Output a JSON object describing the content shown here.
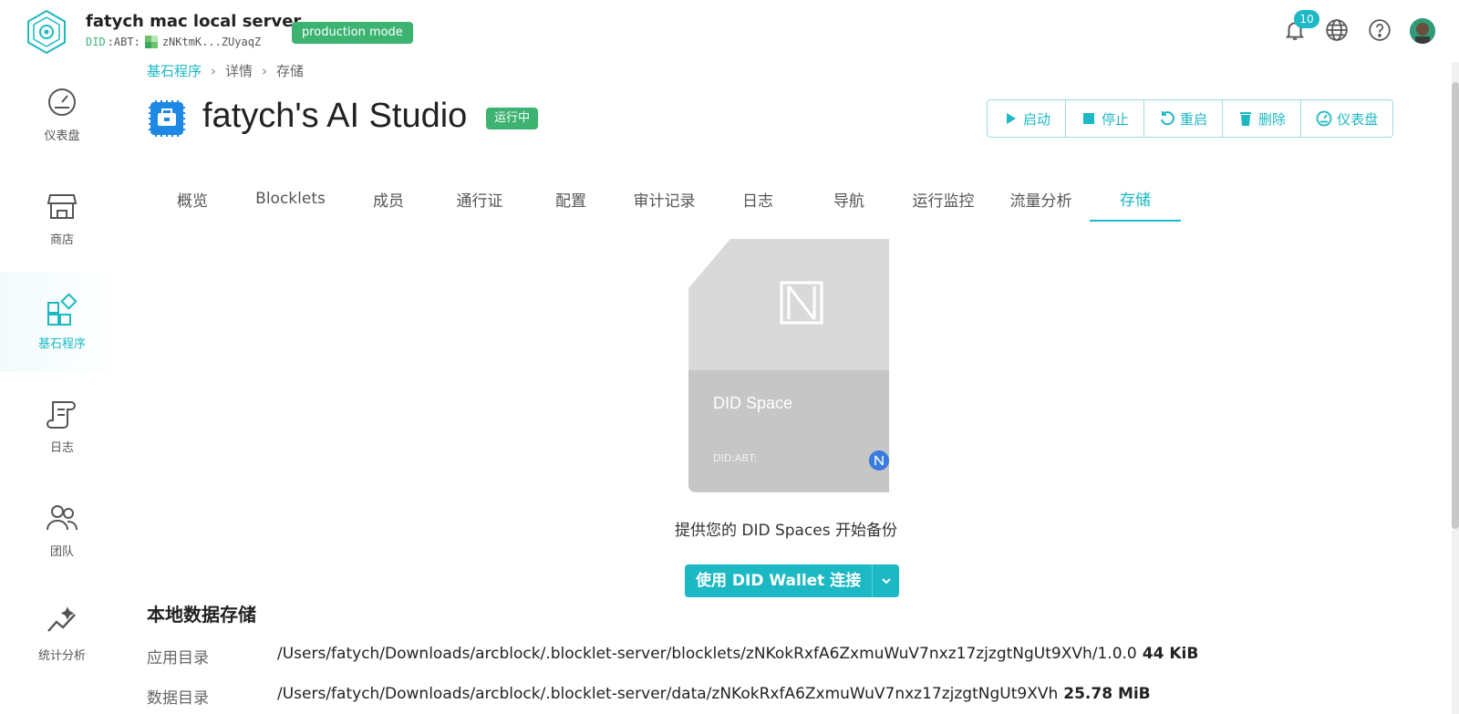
{
  "header": {
    "server_name": "fatych mac local server",
    "did_prefix": "DID",
    "did_type": ":ABT:",
    "did_short": "zNKtmK...ZUyaqZ",
    "mode_badge": "production mode",
    "notification_count": "10"
  },
  "sidebar": {
    "items": [
      {
        "label": "仪表盘",
        "icon": "gauge-icon"
      },
      {
        "label": "商店",
        "icon": "store-icon"
      },
      {
        "label": "基石程序",
        "icon": "apps-icon",
        "active": true
      },
      {
        "label": "日志",
        "icon": "scroll-icon"
      },
      {
        "label": "团队",
        "icon": "team-icon"
      },
      {
        "label": "统计分析",
        "icon": "analytics-icon"
      }
    ]
  },
  "breadcrumb": {
    "root": "基石程序",
    "detail": "详情",
    "current": "存储"
  },
  "app": {
    "title": "fatych's AI Studio",
    "status": "运行中"
  },
  "actions": {
    "start": "启动",
    "stop": "停止",
    "restart": "重启",
    "delete": "删除",
    "dashboard": "仪表盘"
  },
  "tabs": [
    {
      "label": "概览"
    },
    {
      "label": "Blocklets"
    },
    {
      "label": "成员"
    },
    {
      "label": "通行证"
    },
    {
      "label": "配置"
    },
    {
      "label": "审计记录"
    },
    {
      "label": "日志"
    },
    {
      "label": "导航"
    },
    {
      "label": "运行监控"
    },
    {
      "label": "流量分析"
    },
    {
      "label": "存储",
      "active": true
    }
  ],
  "card": {
    "title": "DID Space",
    "did": "DID:ABT:"
  },
  "backup": {
    "prompt": "提供您的 DID Spaces 开始备份",
    "connect_label": "使用 DID Wallet 连接"
  },
  "local_storage": {
    "title": "本地数据存储",
    "rows": [
      {
        "label": "应用目录",
        "path": "/Users/fatych/Downloads/arcblock/.blocklet-server/blocklets/zNKokRxfA6ZxmuWuV7nxz17zjzgtNgUt9XVh/1.0.0",
        "size": "44 KiB"
      },
      {
        "label": "数据目录",
        "path": "/Users/fatych/Downloads/arcblock/.blocklet-server/data/zNKokRxfA6ZxmuWuV7nxz17zjzgtNgUt9XVh",
        "size": "25.78 MiB"
      }
    ]
  },
  "colors": {
    "accent": "#1cb8c4",
    "status_green": "#3cb371"
  }
}
